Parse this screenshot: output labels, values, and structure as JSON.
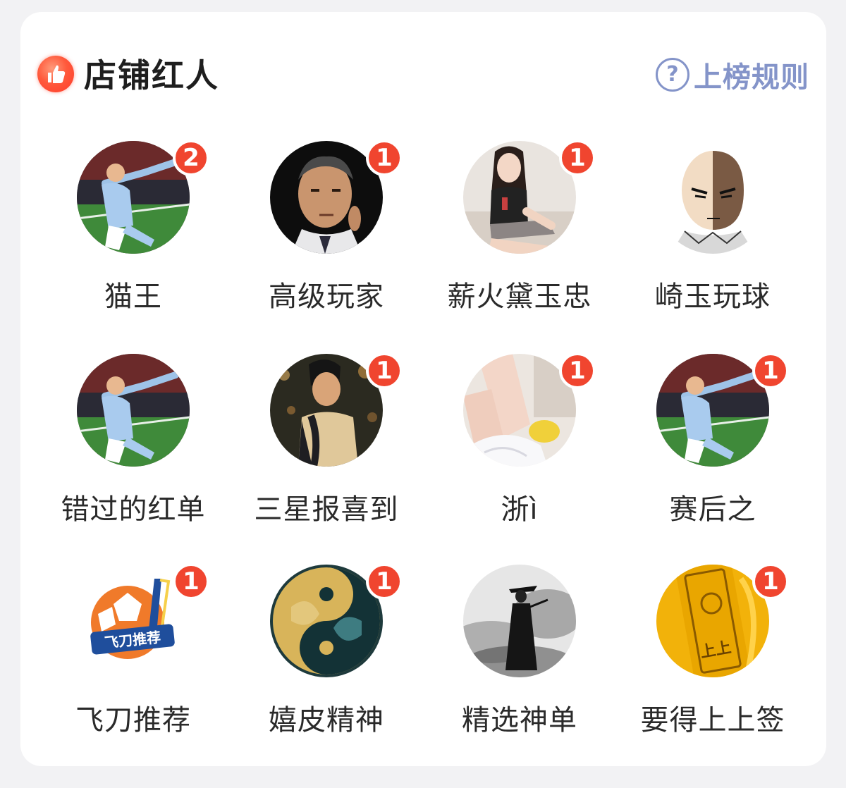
{
  "section": {
    "title": "店铺红人",
    "title_icon": "thumbs-up-icon",
    "rules_label": "上榜规则",
    "rules_icon": "question-circle-icon",
    "accent": "#f0452f",
    "link_color": "#8494c9"
  },
  "influencers": [
    {
      "name": "猫王",
      "badge": "2",
      "avatar": "footballer-celebrating"
    },
    {
      "name": "高级玩家",
      "badge": "1",
      "avatar": "man-portrait"
    },
    {
      "name": "薪火黛玉忠",
      "badge": "1",
      "avatar": "woman-seated"
    },
    {
      "name": "崎玉玩球",
      "badge": "",
      "avatar": "anime-bald-hero"
    },
    {
      "name": "错过的红单",
      "badge": "",
      "avatar": "footballer-celebrating"
    },
    {
      "name": "三星报喜到",
      "badge": "1",
      "avatar": "boy-city-night"
    },
    {
      "name": "浙ì",
      "badge": "1",
      "avatar": "legs-closeup"
    },
    {
      "name": "赛后之",
      "badge": "1",
      "avatar": "footballer-celebrating"
    },
    {
      "name": "飞刀推荐",
      "badge": "1",
      "avatar": "football-logo",
      "logo_text": "飞刀推荐"
    },
    {
      "name": "嬉皮精神",
      "badge": "1",
      "avatar": "yin-yang-koi"
    },
    {
      "name": "精选神单",
      "badge": "",
      "avatar": "swordsman-ink"
    },
    {
      "name": "要得上上签",
      "badge": "1",
      "avatar": "golden-talisman",
      "logo_text": "上上"
    }
  ]
}
